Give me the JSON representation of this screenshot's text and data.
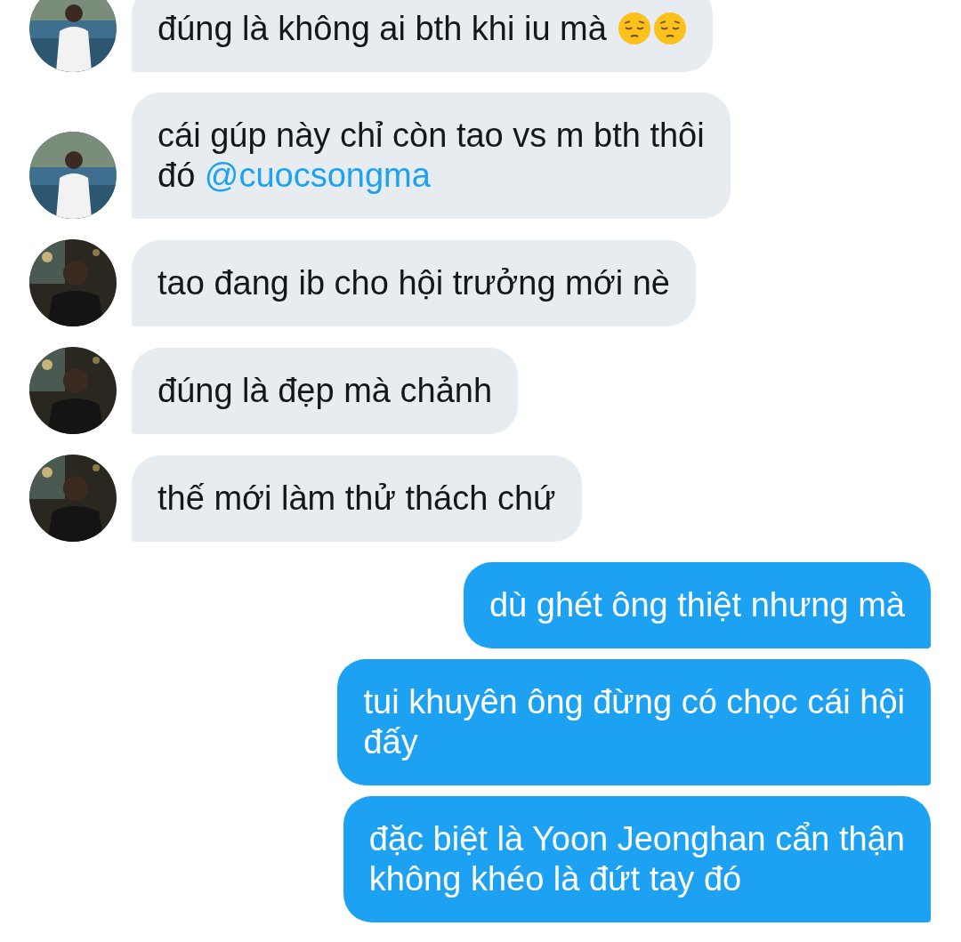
{
  "messages": [
    {
      "kind": "incoming",
      "avatar": {
        "kind": "sea"
      },
      "parts": [
        {
          "kind": "text",
          "text": "đúng là không ai bth khi iu mà "
        }
      ],
      "emoji": [
        {
          "kind": "pensive"
        },
        {
          "kind": "pensive"
        }
      ]
    },
    {
      "kind": "incoming",
      "avatar": {
        "kind": "sea"
      },
      "parts": [
        {
          "kind": "text",
          "text": "cái gúp này chỉ còn tao vs m bth thôi\nđó "
        },
        {
          "kind": "mention",
          "text": "@cuocsongma"
        }
      ]
    },
    {
      "kind": "incoming",
      "avatar": {
        "kind": "night"
      },
      "parts": [
        {
          "kind": "text",
          "text": "tao đang ib cho hội trưởng mới nè"
        }
      ]
    },
    {
      "kind": "incoming",
      "avatar": {
        "kind": "night"
      },
      "parts": [
        {
          "kind": "text",
          "text": "đúng là đẹp mà chảnh"
        }
      ]
    },
    {
      "kind": "incoming",
      "avatar": {
        "kind": "night"
      },
      "parts": [
        {
          "kind": "text",
          "text": "thế mới làm thử thách chứ"
        }
      ]
    },
    {
      "kind": "outgoing",
      "parts": [
        {
          "kind": "text",
          "text": "dù ghét ông thiệt nhưng mà"
        }
      ]
    },
    {
      "kind": "outgoing",
      "parts": [
        {
          "kind": "text",
          "text": "tui khuyên ông đừng có chọc cái hội\nđấy"
        }
      ]
    },
    {
      "kind": "outgoing",
      "parts": [
        {
          "kind": "text",
          "text": "đặc biệt là Yoon Jeonghan cẩn thận\nkhông khéo là đứt tay đó"
        }
      ]
    }
  ]
}
